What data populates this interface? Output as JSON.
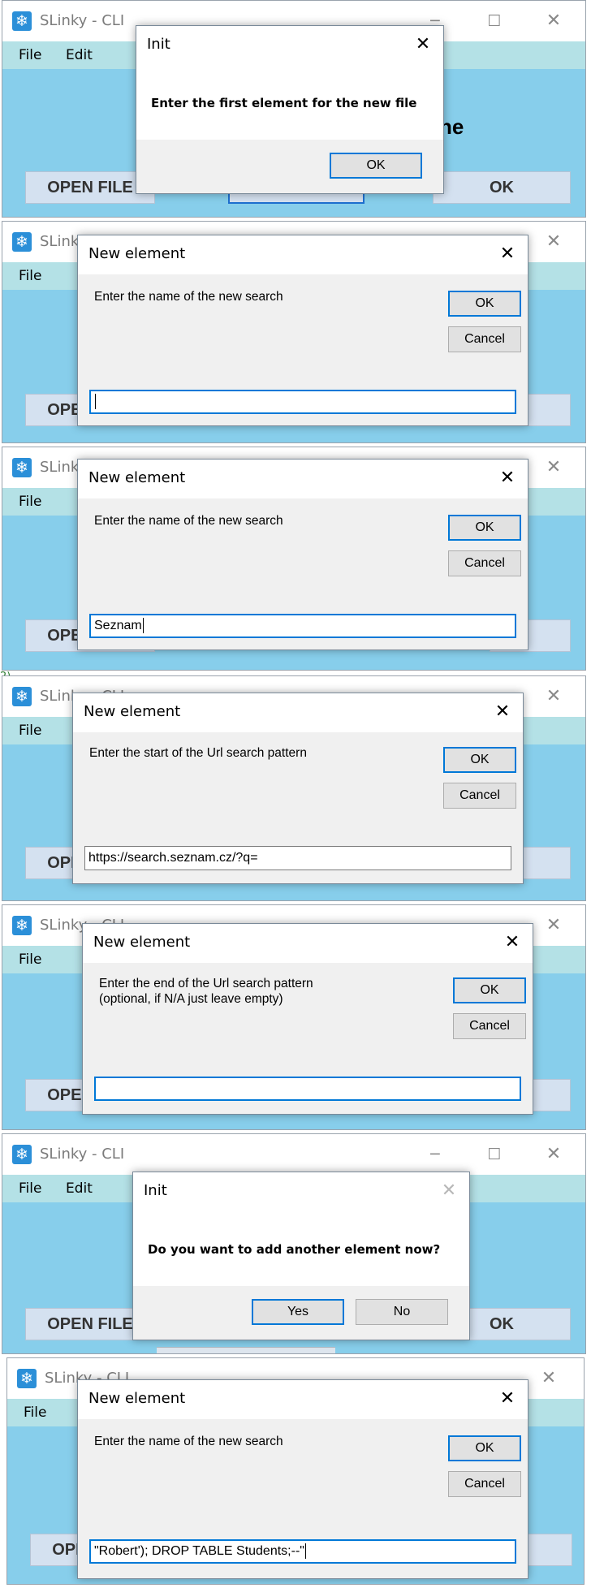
{
  "window": {
    "title": "SLinky - CLI",
    "controls": {
      "minimize": "─",
      "maximize": "☐",
      "close": "✕"
    },
    "icon": "app-snowflake-icon"
  },
  "menu": {
    "file": "File",
    "edit": "Edit"
  },
  "background": {
    "open_file_button": "OPEN FILE",
    "ok_button": "OK",
    "partial_label": "ne"
  },
  "frames": [
    {
      "dialog_title": "Init",
      "message": "Enter the first element for the new file",
      "ok": "OK"
    },
    {
      "dialog_title": "New element",
      "message": "Enter the name of the new search",
      "ok": "OK",
      "cancel": "Cancel",
      "input_value": ""
    },
    {
      "dialog_title": "New element",
      "message": "Enter the name of the new search",
      "ok": "OK",
      "cancel": "Cancel",
      "input_value": "Seznam"
    },
    {
      "dialog_title": "New element",
      "message": "Enter the start of the Url search pattern",
      "ok": "OK",
      "cancel": "Cancel",
      "input_value": "https://search.seznam.cz/?q="
    },
    {
      "dialog_title": "New element",
      "message": "Enter the end of the Url search pattern\n (optional, if N/A just leave empty)",
      "ok": "OK",
      "cancel": "Cancel",
      "input_value": ""
    },
    {
      "dialog_title": "Init",
      "message": "Do you want to add another element now?",
      "yes": "Yes",
      "no": "No"
    },
    {
      "dialog_title": "New element",
      "message": "Enter the name of the new search",
      "ok": "OK",
      "cancel": "Cancel",
      "input_value": "\"Robert'); DROP TABLE Students;--\""
    }
  ],
  "stray_text": "2)",
  "colors": {
    "client_area": "#87ceeb",
    "menu_bar": "#b4e1e6",
    "focus_blue": "#0078d7"
  }
}
